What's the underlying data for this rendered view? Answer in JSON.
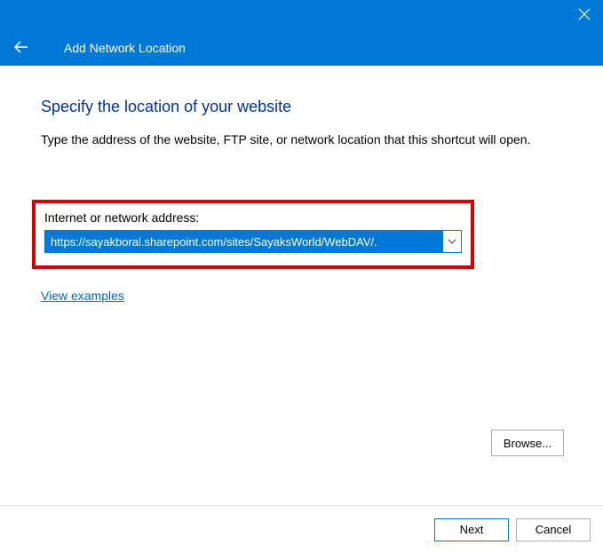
{
  "titlebar": {},
  "header": {
    "title": "Add Network Location"
  },
  "content": {
    "heading": "Specify the location of your website",
    "subtext": "Type the address of the website, FTP site, or network location that this shortcut will open.",
    "field_label": "Internet or network address:",
    "address_value": "https://sayakboral.sharepoint.com/sites/SayaksWorld/WebDAV/.",
    "browse_label": "Browse...",
    "view_examples": "View examples"
  },
  "footer": {
    "next": "Next",
    "cancel": "Cancel"
  }
}
